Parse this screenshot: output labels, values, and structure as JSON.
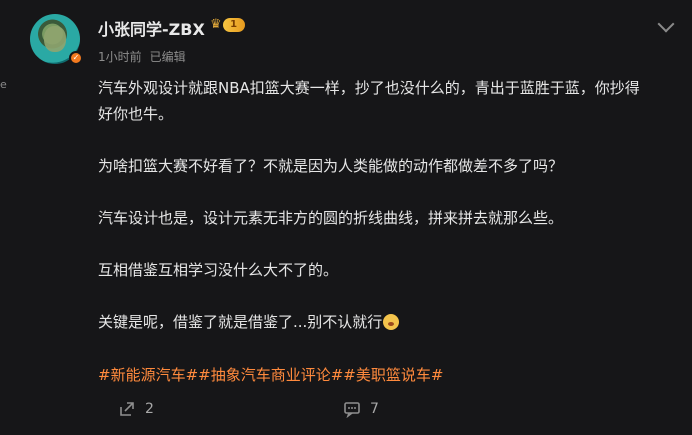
{
  "left_marker": "e",
  "post": {
    "user_name": "小张同学-ZBX",
    "level_badge": "1",
    "time": "1小时前",
    "edited": "已编辑",
    "paragraphs": [
      "汽车外观设计就跟NBA扣篮大赛一样，抄了也没什么的，青出于蓝胜于蓝，你抄得",
      "好你也牛。",
      "为啥扣篮大赛不好看了？不就是因为人类能做的动作都做差不多了吗？",
      "汽车设计也是，设计元素无非方的圆的折线曲线，拼来拼去就那么些。",
      "互相借鉴互相学习没什么大不了的。",
      "关键是呢，借鉴了就是借鉴了...别不认就行"
    ],
    "tags": "#新能源汽车##抽象汽车商业评论##美职篮说车#"
  },
  "actions": {
    "share_count": "2",
    "comment_count": "7"
  },
  "colors": {
    "background": "#161618",
    "text": "#e6e6e6",
    "muted": "#8d8d8d",
    "tag": "#ff8a3d",
    "verify": "#f37a1f"
  },
  "icons": [
    "avatar",
    "verified-badge-icon",
    "crown-icon",
    "chevron-down-icon",
    "emoji-icon",
    "share-icon",
    "comment-icon"
  ]
}
